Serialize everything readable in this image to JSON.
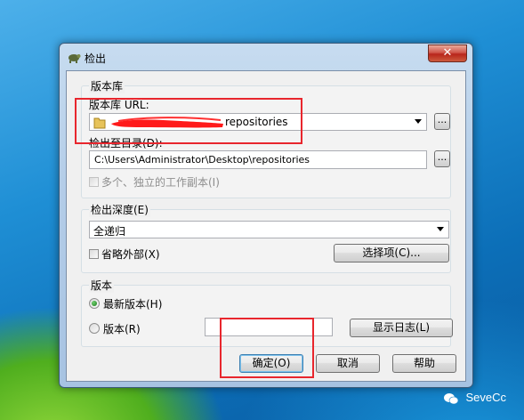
{
  "window": {
    "title": "检出",
    "close_label": "✕"
  },
  "repository_group": {
    "title": "版本库",
    "url_label": "版本库 URL:",
    "url_value": "repositories",
    "browse_label": "...",
    "checkout_dir_label": "检出至目录(D):",
    "checkout_dir_value": "C:\\Users\\Administrator\\Desktop\\repositories",
    "dir_browse_label": "...",
    "multiple_label": "多个、独立的工作副本(I)"
  },
  "depth_group": {
    "title": "检出深度(E)",
    "depth_value": "全递归",
    "omit_externals_label": "省略外部(X)",
    "options_button": "选择项(C)..."
  },
  "revision_group": {
    "title": "版本",
    "head_label": "最新版本(H)",
    "revision_label": "版本(R)",
    "revision_value": "",
    "show_log_button": "显示日志(L)"
  },
  "buttons": {
    "ok": "确定(O)",
    "cancel": "取消",
    "help": "帮助"
  },
  "watermark": {
    "text": "SeveCc"
  },
  "colors": {
    "annotation": "#e8262d",
    "redaction": "#ff1a1a"
  }
}
